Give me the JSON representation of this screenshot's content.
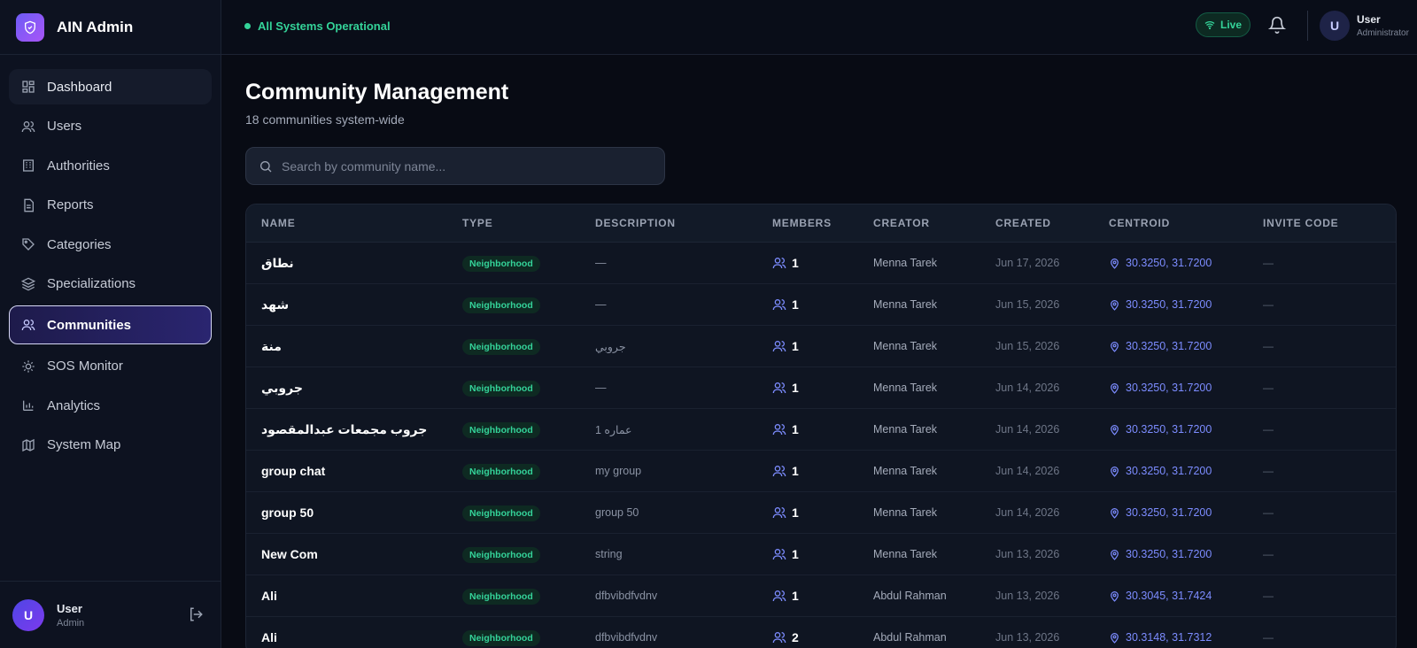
{
  "brand": {
    "name": "AIN Admin",
    "logo_icon": "shield-icon"
  },
  "sidebar": {
    "items": [
      {
        "label": "Dashboard",
        "icon": "dashboard-icon"
      },
      {
        "label": "Users",
        "icon": "users-icon"
      },
      {
        "label": "Authorities",
        "icon": "building-icon"
      },
      {
        "label": "Reports",
        "icon": "document-icon"
      },
      {
        "label": "Categories",
        "icon": "tag-icon"
      },
      {
        "label": "Specializations",
        "icon": "layers-icon"
      },
      {
        "label": "Communities",
        "icon": "users-icon",
        "active": true
      },
      {
        "label": "SOS Monitor",
        "icon": "alert-icon"
      },
      {
        "label": "Analytics",
        "icon": "bar-chart-icon"
      },
      {
        "label": "System Map",
        "icon": "map-icon"
      }
    ],
    "footer": {
      "avatar": "U",
      "name": "User",
      "role": "Admin"
    }
  },
  "header": {
    "status": "All Systems Operational",
    "live": "Live",
    "user": {
      "avatar": "U",
      "name": "User",
      "role": "Administrator"
    }
  },
  "main": {
    "title": "Community Management",
    "subtitle": "18 communities system-wide",
    "search": {
      "placeholder": "Search by community name...",
      "value": ""
    },
    "table": {
      "columns": [
        "NAME",
        "TYPE",
        "DESCRIPTION",
        "MEMBERS",
        "CREATOR",
        "CREATED",
        "CENTROID",
        "INVITE CODE"
      ],
      "rows": [
        {
          "name": "نطاق",
          "type": "Neighborhood",
          "description": "—",
          "members": "1",
          "creator": "Menna Tarek",
          "created": "Jun 17, 2026",
          "centroid": "30.3250, 31.7200",
          "invite": "—"
        },
        {
          "name": "شهد",
          "type": "Neighborhood",
          "description": "—",
          "members": "1",
          "creator": "Menna Tarek",
          "created": "Jun 15, 2026",
          "centroid": "30.3250, 31.7200",
          "invite": "—"
        },
        {
          "name": "منة",
          "type": "Neighborhood",
          "description": "جروبي",
          "members": "1",
          "creator": "Menna Tarek",
          "created": "Jun 15, 2026",
          "centroid": "30.3250, 31.7200",
          "invite": "—"
        },
        {
          "name": "جروبي",
          "type": "Neighborhood",
          "description": "—",
          "members": "1",
          "creator": "Menna Tarek",
          "created": "Jun 14, 2026",
          "centroid": "30.3250, 31.7200",
          "invite": "—"
        },
        {
          "name": "جروب مجمعات عبدالمقصود",
          "type": "Neighborhood",
          "description": "عماره 1",
          "members": "1",
          "creator": "Menna Tarek",
          "created": "Jun 14, 2026",
          "centroid": "30.3250, 31.7200",
          "invite": "—"
        },
        {
          "name": "group chat",
          "type": "Neighborhood",
          "description": "my group",
          "members": "1",
          "creator": "Menna Tarek",
          "created": "Jun 14, 2026",
          "centroid": "30.3250, 31.7200",
          "invite": "—"
        },
        {
          "name": "group 50",
          "type": "Neighborhood",
          "description": "group 50",
          "members": "1",
          "creator": "Menna Tarek",
          "created": "Jun 14, 2026",
          "centroid": "30.3250, 31.7200",
          "invite": "—"
        },
        {
          "name": "New Com",
          "type": "Neighborhood",
          "description": "string",
          "members": "1",
          "creator": "Menna Tarek",
          "created": "Jun 13, 2026",
          "centroid": "30.3250, 31.7200",
          "invite": "—"
        },
        {
          "name": "Ali",
          "type": "Neighborhood",
          "description": "dfbvibdfvdnv",
          "members": "1",
          "creator": "Abdul Rahman",
          "created": "Jun 13, 2026",
          "centroid": "30.3045, 31.7424",
          "invite": "—"
        },
        {
          "name": "Ali",
          "type": "Neighborhood",
          "description": "dfbvibdfvdnv",
          "members": "2",
          "creator": "Abdul Rahman",
          "created": "Jun 13, 2026",
          "centroid": "30.3148, 31.7312",
          "invite": "—"
        }
      ]
    }
  },
  "colors": {
    "accent": "#7c8cff",
    "success": "#34d399",
    "background": "#080b14",
    "sidebar": "#0d1220"
  }
}
